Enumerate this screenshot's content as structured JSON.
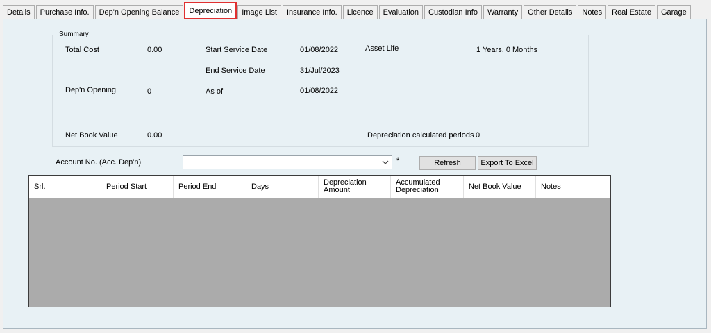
{
  "tabs": [
    {
      "label": "Details"
    },
    {
      "label": "Purchase Info."
    },
    {
      "label": "Dep'n Opening Balance"
    },
    {
      "label": "Depreciation",
      "active": true
    },
    {
      "label": "Image List"
    },
    {
      "label": "Insurance Info."
    },
    {
      "label": "Licence"
    },
    {
      "label": "Evaluation"
    },
    {
      "label": "Custodian Info"
    },
    {
      "label": "Warranty"
    },
    {
      "label": "Other Details"
    },
    {
      "label": "Notes"
    },
    {
      "label": "Real Estate"
    },
    {
      "label": "Garage"
    }
  ],
  "summary": {
    "title": "Summary",
    "total_cost_label": "Total Cost",
    "total_cost_value": "0.00",
    "start_service_label": "Start Service Date",
    "start_service_value": "01/08/2022",
    "asset_life_label": "Asset Life",
    "asset_life_value": "1 Years, 0 Months",
    "end_service_label": "End Service Date",
    "end_service_value": "31/Jul/2023",
    "depn_opening_label": "Dep'n Opening",
    "depn_opening_value": "0",
    "as_of_label": "As of",
    "as_of_value": "01/08/2022",
    "net_book_label": "Net Book Value",
    "net_book_value": "0.00",
    "dep_periods_label": "Depreciation calculated periods",
    "dep_periods_value": "0"
  },
  "account": {
    "label": "Account No. (Acc. Dep'n)",
    "value": "",
    "required_marker": "*"
  },
  "buttons": {
    "refresh": "Refresh",
    "export": "Export To Excel"
  },
  "grid": {
    "columns": [
      {
        "label": "Srl."
      },
      {
        "label": "Period Start"
      },
      {
        "label": "Period End"
      },
      {
        "label": "Days"
      },
      {
        "label": "Depreciation Amount"
      },
      {
        "label": "Accumulated Depreciation"
      },
      {
        "label": "Net Book Value"
      },
      {
        "label": "Notes"
      }
    ]
  },
  "colors": {
    "active_tab_outline": "#e03030",
    "panel_bg": "#e8f1f5",
    "grid_empty_bg": "#ababab"
  }
}
